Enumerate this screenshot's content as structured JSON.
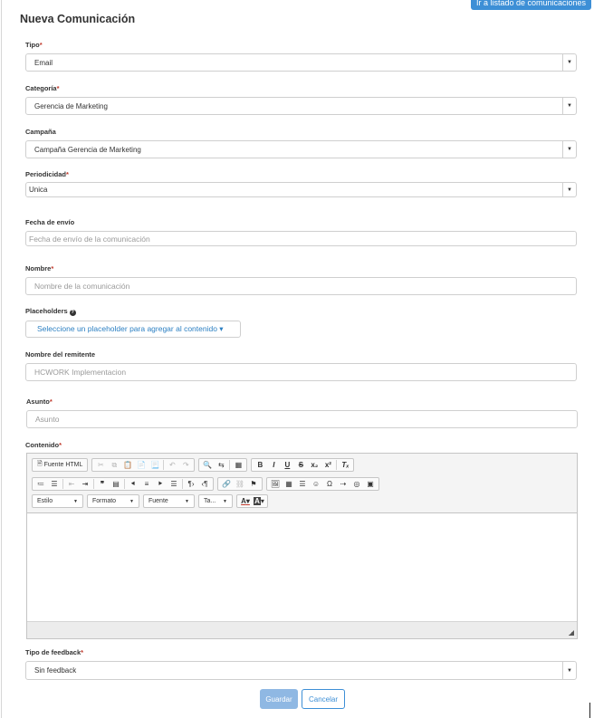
{
  "header": {
    "title": "Nueva Comunicación",
    "list_link": "Ir a listado de comunicaciones"
  },
  "form": {
    "tipo": {
      "label": "Tipo",
      "required_mark": "*",
      "value": "Email"
    },
    "categoria": {
      "label": "Categoría",
      "required_mark": "*",
      "value": "Gerencia de Marketing"
    },
    "campana": {
      "label": "Campaña",
      "value": "Campaña Gerencia de Marketing"
    },
    "periodicidad": {
      "label": "Periodicidad",
      "required_mark": "*",
      "value": "Unica"
    },
    "fecha_envio": {
      "label": "Fecha de envío",
      "placeholder": "Fecha de envío de la comunicación"
    },
    "nombre": {
      "label": "Nombre",
      "required_mark": "*",
      "placeholder": "Nombre de la comunicación"
    },
    "placeholders": {
      "label": "Placeholders",
      "button": "Seleccione un placeholder para agregar al contenido ▾"
    },
    "remitente": {
      "label": "Nombre del remitente",
      "placeholder": "HCWORK Implementacion"
    },
    "asunto": {
      "label": "Asunto",
      "required_mark": "*",
      "placeholder": "Asunto"
    },
    "contenido": {
      "label": "Contenido",
      "required_mark": "*"
    },
    "feedback": {
      "label": "Tipo de feedback",
      "required_mark": "*",
      "value": "Sin feedback"
    }
  },
  "editor": {
    "source_button": "Fuente HTML",
    "style_combo": "Estilo",
    "format_combo": "Formato",
    "font_combo": "Fuente",
    "size_combo": "Ta...",
    "text_color": "A",
    "bg_color": "A"
  },
  "actions": {
    "save": "Guardar",
    "cancel": "Cancelar"
  },
  "colors": {
    "primary": "#3d8fd6",
    "save_disabled": "#8fb8e3",
    "required": "#c0392b"
  }
}
